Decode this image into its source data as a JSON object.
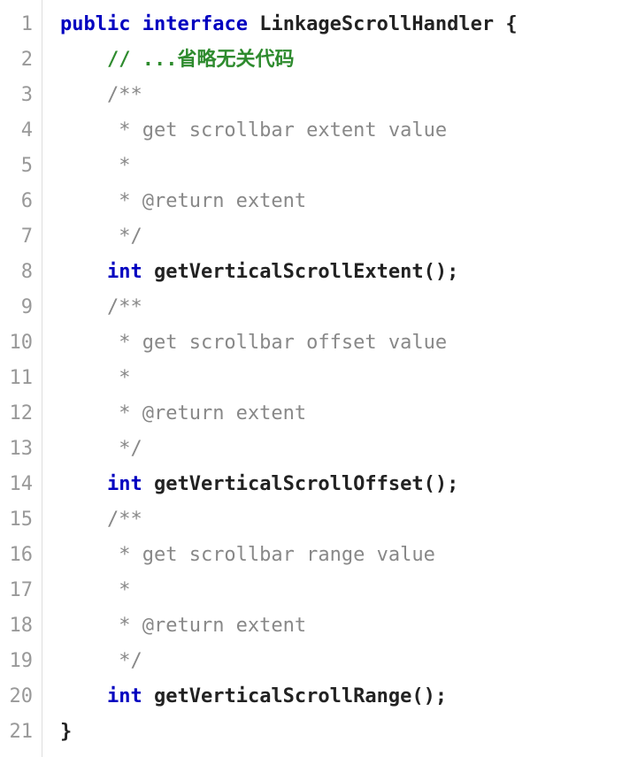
{
  "lines": [
    {
      "num": "1",
      "indent": "",
      "tokens": [
        {
          "cls": "kw",
          "t": "public"
        },
        {
          "cls": "plain",
          "t": " "
        },
        {
          "cls": "kw",
          "t": "interface"
        },
        {
          "cls": "plain",
          "t": " LinkageScrollHandler "
        },
        {
          "cls": "punct",
          "t": "{"
        }
      ]
    },
    {
      "num": "2",
      "indent": "    ",
      "tokens": [
        {
          "cls": "comment-green",
          "t": "// ...省略无关代码"
        }
      ]
    },
    {
      "num": "3",
      "indent": "    ",
      "tokens": [
        {
          "cls": "comment-gray",
          "t": "/**"
        }
      ]
    },
    {
      "num": "4",
      "indent": "    ",
      "tokens": [
        {
          "cls": "comment-gray",
          "t": " * get scrollbar extent value"
        }
      ]
    },
    {
      "num": "5",
      "indent": "    ",
      "tokens": [
        {
          "cls": "comment-gray",
          "t": " *"
        }
      ]
    },
    {
      "num": "6",
      "indent": "    ",
      "tokens": [
        {
          "cls": "comment-gray",
          "t": " * @return extent"
        }
      ]
    },
    {
      "num": "7",
      "indent": "    ",
      "tokens": [
        {
          "cls": "comment-gray",
          "t": " */"
        }
      ]
    },
    {
      "num": "8",
      "indent": "    ",
      "tokens": [
        {
          "cls": "kw",
          "t": "int"
        },
        {
          "cls": "plain",
          "t": " "
        },
        {
          "cls": "method",
          "t": "getVerticalScrollExtent"
        },
        {
          "cls": "punct",
          "t": "();"
        }
      ]
    },
    {
      "num": "9",
      "indent": "    ",
      "tokens": [
        {
          "cls": "comment-gray",
          "t": "/**"
        }
      ]
    },
    {
      "num": "10",
      "indent": "    ",
      "tokens": [
        {
          "cls": "comment-gray",
          "t": " * get scrollbar offset value"
        }
      ]
    },
    {
      "num": "11",
      "indent": "    ",
      "tokens": [
        {
          "cls": "comment-gray",
          "t": " *"
        }
      ]
    },
    {
      "num": "12",
      "indent": "    ",
      "tokens": [
        {
          "cls": "comment-gray",
          "t": " * @return extent"
        }
      ]
    },
    {
      "num": "13",
      "indent": "    ",
      "tokens": [
        {
          "cls": "comment-gray",
          "t": " */"
        }
      ]
    },
    {
      "num": "14",
      "indent": "    ",
      "tokens": [
        {
          "cls": "kw",
          "t": "int"
        },
        {
          "cls": "plain",
          "t": " "
        },
        {
          "cls": "method",
          "t": "getVerticalScrollOffset"
        },
        {
          "cls": "punct",
          "t": "();"
        }
      ]
    },
    {
      "num": "15",
      "indent": "    ",
      "tokens": [
        {
          "cls": "comment-gray",
          "t": "/**"
        }
      ]
    },
    {
      "num": "16",
      "indent": "    ",
      "tokens": [
        {
          "cls": "comment-gray",
          "t": " * get scrollbar range value"
        }
      ]
    },
    {
      "num": "17",
      "indent": "    ",
      "tokens": [
        {
          "cls": "comment-gray",
          "t": " *"
        }
      ]
    },
    {
      "num": "18",
      "indent": "    ",
      "tokens": [
        {
          "cls": "comment-gray",
          "t": " * @return extent"
        }
      ]
    },
    {
      "num": "19",
      "indent": "    ",
      "tokens": [
        {
          "cls": "comment-gray",
          "t": " */"
        }
      ]
    },
    {
      "num": "20",
      "indent": "    ",
      "tokens": [
        {
          "cls": "kw",
          "t": "int"
        },
        {
          "cls": "plain",
          "t": " "
        },
        {
          "cls": "method",
          "t": "getVerticalScrollRange"
        },
        {
          "cls": "punct",
          "t": "();"
        }
      ]
    },
    {
      "num": "21",
      "indent": "",
      "tokens": [
        {
          "cls": "punct",
          "t": "}"
        }
      ]
    }
  ]
}
